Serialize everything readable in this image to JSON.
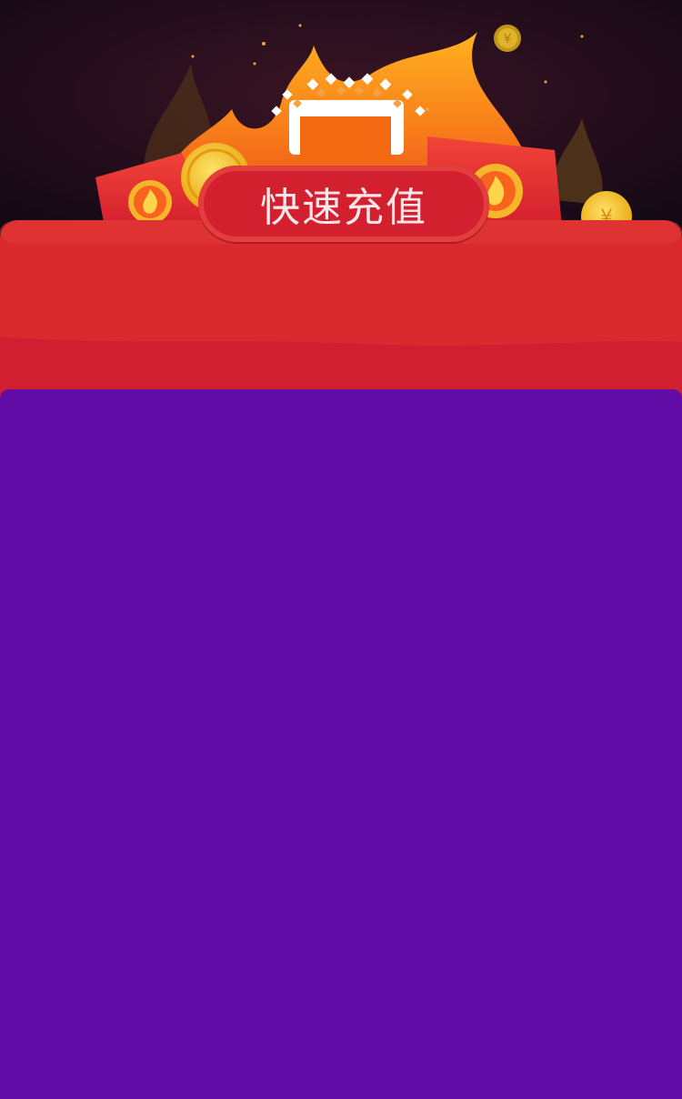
{
  "header": {
    "title": "快速充值"
  },
  "colors": {
    "page_background": "#620ca8",
    "banner_red": "#d82a2e",
    "banner_red_dark": "#cf1f30",
    "flame_orange": "#f46a12",
    "coin_gold": "#f5c21a",
    "dark_sky": "#1b0c1e"
  },
  "icons": [
    "flame-icon",
    "coin-icon",
    "red-envelope-icon",
    "gift-box-icon"
  ]
}
